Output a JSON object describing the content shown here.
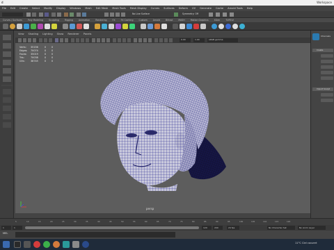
{
  "window": {
    "title": "d",
    "account": "Workspace"
  },
  "menu": [
    "File",
    "Edit",
    "Create",
    "Select",
    "Modify",
    "Display",
    "Windows",
    "Mesh",
    "Edit Mesh",
    "Mesh Tools",
    "Mesh Display",
    "Curves",
    "Surfaces",
    "Deform",
    "UV",
    "Generate",
    "Cache",
    "Arnold Tools",
    "Help"
  ],
  "status_line": {
    "no_live_surface": "No Live Surface",
    "symmetry": "Symmetry: Off"
  },
  "shelf_tabs": [
    "Curves / Surfaces",
    "Poly Modeling",
    "Sculpting",
    "Rigging",
    "Animation",
    "Rendering",
    "FX",
    "FX Caching",
    "Custom",
    "Arnold",
    "Bifrost",
    "MASH",
    "Motion Graphics",
    "XGen",
    "TURTLE"
  ],
  "panel_menu": [
    "View",
    "Shading",
    "Lighting",
    "Show",
    "Renderer",
    "Panels"
  ],
  "viewport_toolbar": {
    "value_a": "0.00",
    "value_b": "1.00",
    "colorspace": "sRGB gamma"
  },
  "hud": {
    "rows": [
      {
        "label": "Verts:",
        "a": "35156",
        "b": "0",
        "c": "0"
      },
      {
        "label": "Edges:",
        "a": "70074",
        "b": "0",
        "c": "0"
      },
      {
        "label": "Faces:",
        "a": "35019",
        "b": "0",
        "c": "0"
      },
      {
        "label": "Tris:",
        "a": "70038",
        "b": "0",
        "c": "0"
      },
      {
        "label": "UVs:",
        "a": "38745",
        "b": "0",
        "c": "0"
      }
    ]
  },
  "camera_label": "persp",
  "right_panel": {
    "tab": "Channels",
    "section_create": "Create",
    "section_sculpt": "Import Sculpt"
  },
  "timeline": {
    "ticks": [
      "5",
      "10",
      "15",
      "20",
      "25",
      "30",
      "35",
      "40",
      "45",
      "50",
      "55",
      "60",
      "65",
      "70",
      "75",
      "80",
      "85",
      "90",
      "95",
      "100",
      "105",
      "110",
      "115",
      "120"
    ]
  },
  "range": {
    "start": "1",
    "end": "120",
    "anim_start": "1",
    "anim_end": "200",
    "char_set": "No Character Set",
    "anim_layer": "No Anim Layer",
    "fps": "24 fps"
  },
  "mel": {
    "label": "MEL"
  },
  "weather": {
    "temp": "11°C",
    "condition": "Ciel couvert"
  },
  "colors": {
    "viewport_bg": "#5d5d5d",
    "mesh_wire": "#1a1a8a",
    "mesh_face": "#c8c8dc",
    "taskbar": "#1f2b3a"
  }
}
